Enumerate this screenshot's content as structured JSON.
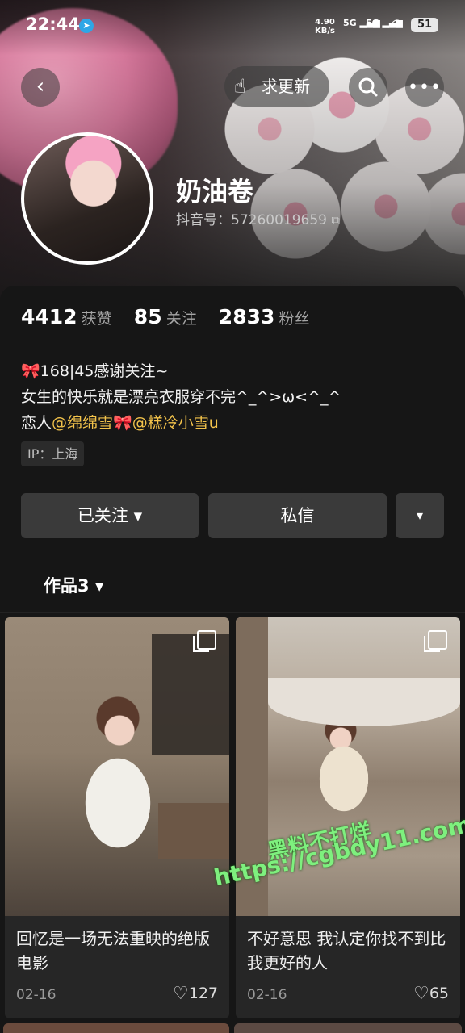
{
  "status_bar": {
    "time": "22:44",
    "net_speed_value": "4.90",
    "net_speed_unit": "KB/s",
    "signal_1": "5G",
    "signal_2": "5G",
    "battery": "51"
  },
  "nav": {
    "update_label": "求更新"
  },
  "profile": {
    "nickname": "奶油卷",
    "douyin_id": "抖音号：57260019659"
  },
  "stats": [
    {
      "value": "4412",
      "label": "获赞"
    },
    {
      "value": "85",
      "label": "关注"
    },
    {
      "value": "2833",
      "label": "粉丝"
    }
  ],
  "bio": {
    "line1": "🎀168|45感谢关注~",
    "line2": "女生的快乐就是漂亮衣服穿不完^_^>ω<^_^",
    "line3_prefix": "恋人",
    "mention1": "@绵绵雪",
    "bow": "🎀",
    "mention2": "@糕冷小雪u"
  },
  "ip_tag": "IP：上海",
  "actions": {
    "follow_label": "已关注 ▾",
    "message_label": "私信",
    "more_label": "▾"
  },
  "works_tab": "作品3 ▾",
  "works": [
    {
      "title": "回忆是一场无法重映的绝版电影",
      "date": "02-16",
      "likes": "127"
    },
    {
      "title": "不好意思 我认定你找不到比我更好的人",
      "date": "02-16",
      "likes": "65"
    }
  ],
  "watermark": {
    "line1": "黑料不打烊",
    "line2": "https://cgbdy11.com"
  },
  "icons": [
    "back-icon",
    "hand-point-icon",
    "search-icon",
    "more-dots-icon",
    "copy-icon",
    "heart-icon",
    "multi-image-icon"
  ]
}
